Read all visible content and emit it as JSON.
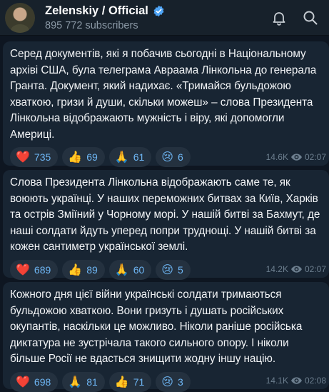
{
  "header": {
    "title": "Zelenskiy / Official",
    "subscribers": "895 772 subscribers",
    "icons": [
      "verified-icon",
      "bell-icon",
      "search-icon"
    ]
  },
  "colors": {
    "background": "#0e1621",
    "bubble": "#182533",
    "chip": "#24313f",
    "count": "#6eb6f4",
    "meta": "#6d7f8f"
  },
  "messages": [
    {
      "text": "Серед документів, які я побачив сьогодні в Національному архіві США, була телеграма Авраама Лінкольна до генерала Гранта. Документ, який надихає. «Тримайся бульдожою хваткою, гризи й души, скільки можеш» – слова Президента Лінкольна відображають мужність і віру, які допомогли Америці.",
      "reactions": [
        {
          "emoji": "❤️",
          "count": "735"
        },
        {
          "emoji": "👍",
          "count": "69"
        },
        {
          "emoji": "🙏",
          "count": "61"
        },
        {
          "emoji": "😢",
          "count": "6"
        }
      ],
      "views": "14.6K",
      "time": "02:07"
    },
    {
      "text": "Слова Президента Лінкольна відображають саме те, як воюють українці. У наших переможних битвах за Київ, Харків та острів Зміїний у Чорному морі. У нашій битві за Бахмут, де наші солдати йдуть уперед попри труднощі. У нашій битві за кожен сантиметр української землі.",
      "reactions": [
        {
          "emoji": "❤️",
          "count": "689"
        },
        {
          "emoji": "👍",
          "count": "89"
        },
        {
          "emoji": "🙏",
          "count": "60"
        },
        {
          "emoji": "😢",
          "count": "5"
        }
      ],
      "views": "14.2K",
      "time": "02:07"
    },
    {
      "text": "Кожного дня цієї війни українські солдати тримаються бульдожою хваткою. Вони гризуть і душать російських окупантів, наскільки це можливо. Ніколи раніше російська диктатура не зустрічала такого сильного опору. І ніколи більше Росії не вдасться знищити жодну іншу націю.",
      "reactions": [
        {
          "emoji": "❤️",
          "count": "698"
        },
        {
          "emoji": "🙏",
          "count": "81"
        },
        {
          "emoji": "👍",
          "count": "71"
        },
        {
          "emoji": "😢",
          "count": "3"
        }
      ],
      "views": "14.1K",
      "time": "02:08"
    }
  ]
}
